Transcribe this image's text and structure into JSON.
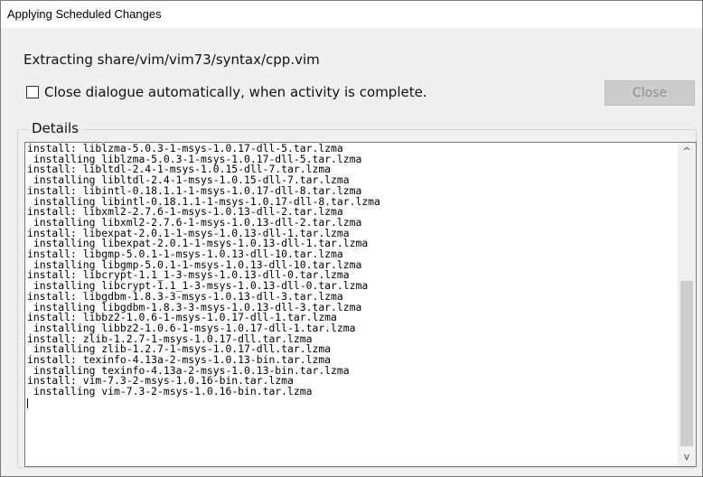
{
  "window": {
    "title": "Applying Scheduled Changes"
  },
  "status_text": "Extracting share/vim/vim73/syntax/cpp.vim",
  "auto_close": {
    "label": "Close dialogue automatically, when activity is complete.",
    "checked": false
  },
  "close_button": {
    "label": "Close",
    "enabled": false
  },
  "details": {
    "label": "Details",
    "log_lines": [
      "install: liblzma-5.0.3-1-msys-1.0.17-dll-5.tar.lzma",
      " installing liblzma-5.0.3-1-msys-1.0.17-dll-5.tar.lzma",
      "install: libltdl-2.4-1-msys-1.0.15-dll-7.tar.lzma",
      " installing libltdl-2.4-1-msys-1.0.15-dll-7.tar.lzma",
      "install: libintl-0.18.1.1-1-msys-1.0.17-dll-8.tar.lzma",
      " installing libintl-0.18.1.1-1-msys-1.0.17-dll-8.tar.lzma",
      "install: libxml2-2.7.6-1-msys-1.0.13-dll-2.tar.lzma",
      " installing libxml2-2.7.6-1-msys-1.0.13-dll-2.tar.lzma",
      "install: libexpat-2.0.1-1-msys-1.0.13-dll-1.tar.lzma",
      " installing libexpat-2.0.1-1-msys-1.0.13-dll-1.tar.lzma",
      "install: libgmp-5.0.1-1-msys-1.0.13-dll-10.tar.lzma",
      " installing libgmp-5.0.1-1-msys-1.0.13-dll-10.tar.lzma",
      "install: libcrypt-1.1_1-3-msys-1.0.13-dll-0.tar.lzma",
      " installing libcrypt-1.1_1-3-msys-1.0.13-dll-0.tar.lzma",
      "install: libgdbm-1.8.3-3-msys-1.0.13-dll-3.tar.lzma",
      " installing libgdbm-1.8.3-3-msys-1.0.13-dll-3.tar.lzma",
      "install: libbz2-1.0.6-1-msys-1.0.17-dll-1.tar.lzma",
      " installing libbz2-1.0.6-1-msys-1.0.17-dll-1.tar.lzma",
      "install: zlib-1.2.7-1-msys-1.0.17-dll.tar.lzma",
      " installing zlib-1.2.7-1-msys-1.0.17-dll.tar.lzma",
      "install: texinfo-4.13a-2-msys-1.0.13-bin.tar.lzma",
      " installing texinfo-4.13a-2-msys-1.0.13-bin.tar.lzma",
      "install: vim-7.3-2-msys-1.0.16-bin.tar.lzma",
      " installing vim-7.3-2-msys-1.0.16-bin.tar.lzma"
    ],
    "scroll_up_icon": "scroll-up-arrow",
    "scroll_down_icon": "scroll-down-arrow",
    "scroll_up_glyph": "^",
    "scroll_down_glyph": "v"
  }
}
